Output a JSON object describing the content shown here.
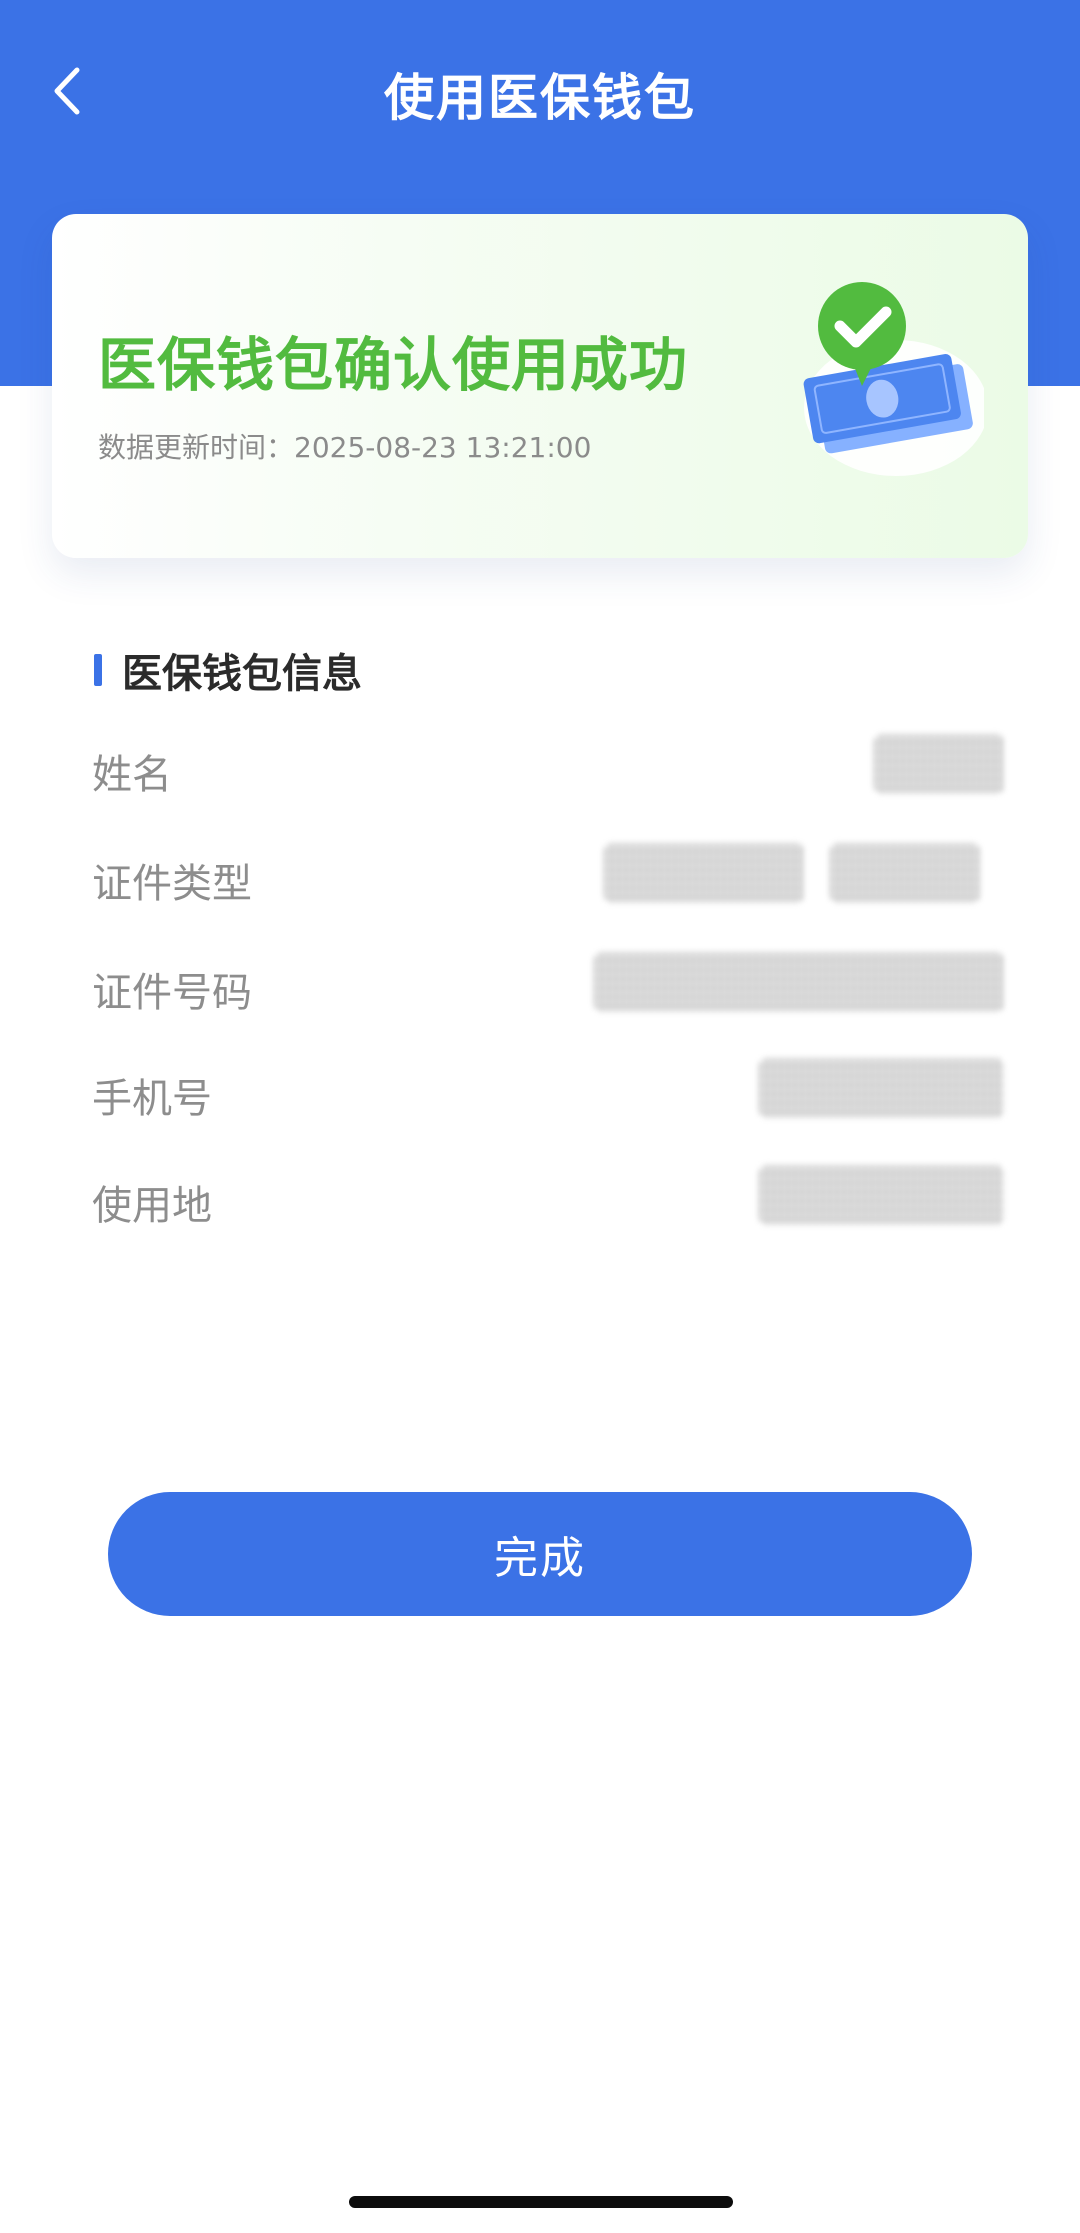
{
  "header": {
    "title": "使用医保钱包",
    "back_icon": "chevron-left-icon"
  },
  "status_card": {
    "title": "医保钱包确认使用成功",
    "update_label": "数据更新时间：",
    "update_time": "2025-08-23 13:21:00",
    "illustration": "check-wallet-icon"
  },
  "section": {
    "title": "医保钱包信息"
  },
  "info_rows": [
    {
      "label": "姓名"
    },
    {
      "label": "证件类型"
    },
    {
      "label": "证件号码"
    },
    {
      "label": "手机号"
    },
    {
      "label": "使用地"
    }
  ],
  "actions": {
    "done_label": "完成"
  },
  "colors": {
    "primary": "#3b72e6",
    "success": "#52bb3f",
    "muted_text": "#8d8d8d"
  }
}
